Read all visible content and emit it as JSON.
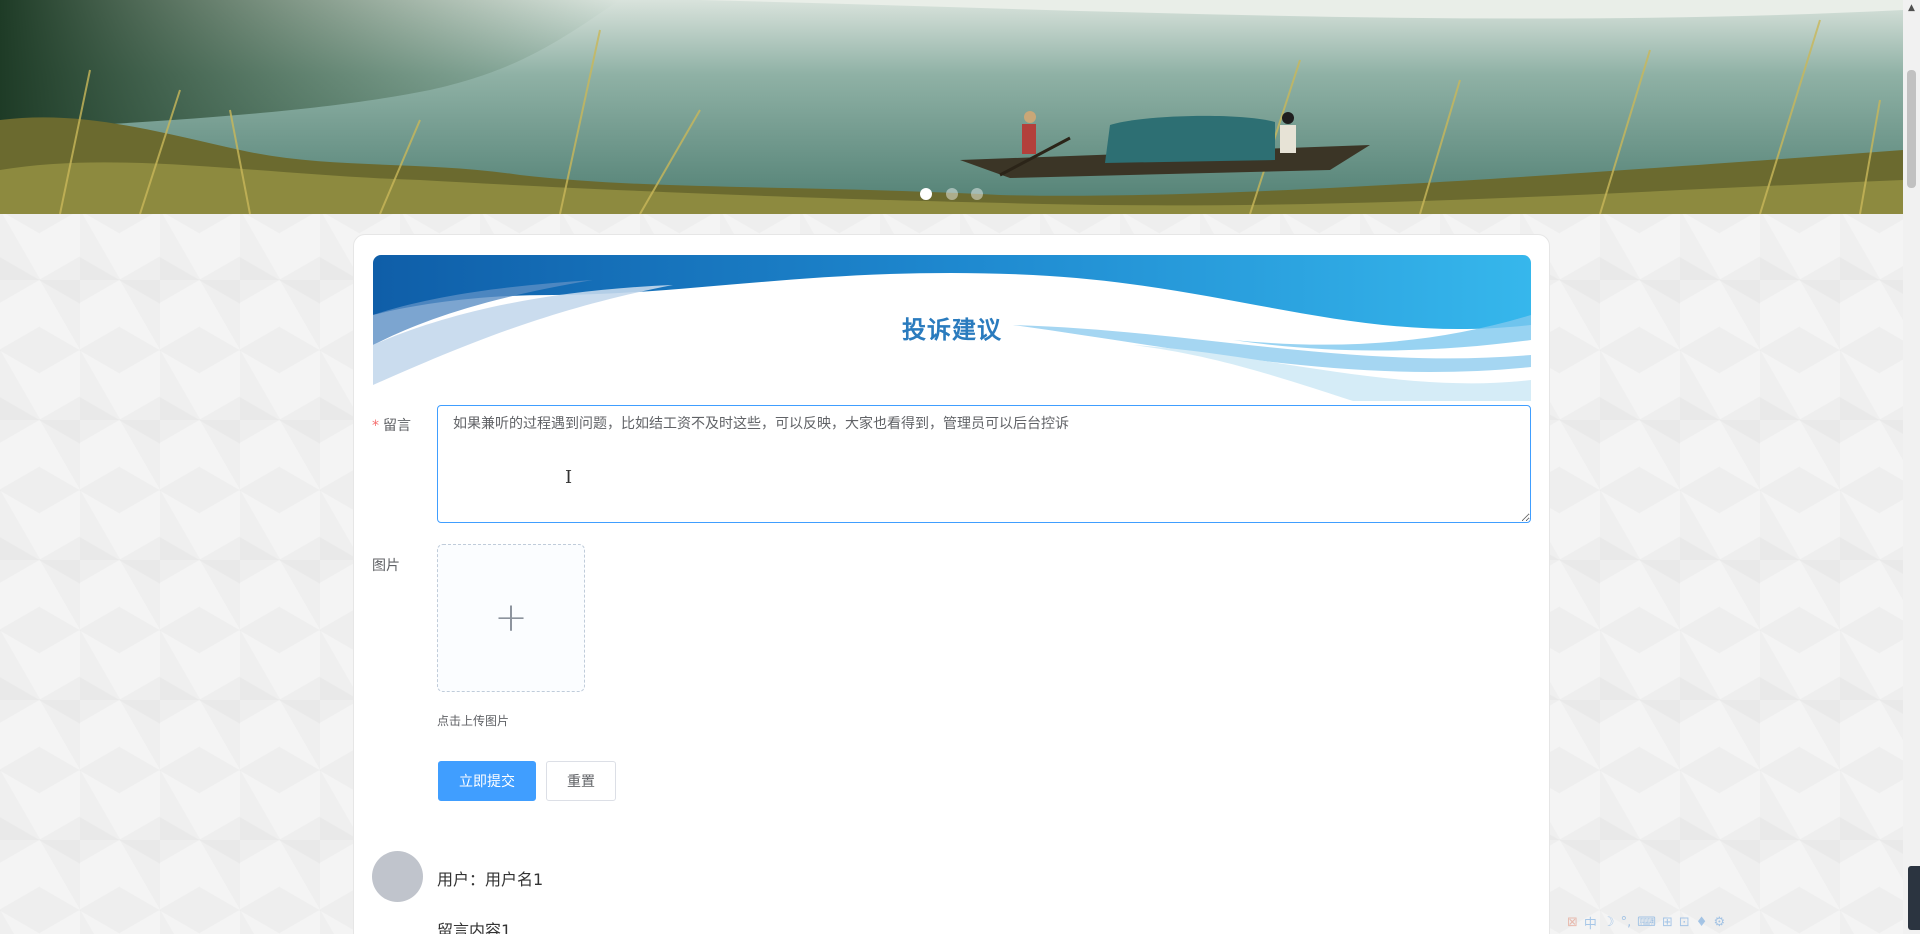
{
  "banner": {
    "dots": [
      {
        "active": true
      },
      {
        "active": false
      },
      {
        "active": false
      }
    ]
  },
  "card": {
    "title": "投诉建议"
  },
  "form": {
    "message": {
      "required_mark": "*",
      "label": "留言",
      "value": "如果兼听的过程遇到问题，比如结工资不及时这些，可以反映，大家也看得到，管理员可以后台控诉"
    },
    "image": {
      "label": "图片",
      "tip": "点击上传图片"
    },
    "submit_label": "立即提交",
    "reset_label": "重置"
  },
  "messages": [
    {
      "user_line": "用户：用户名1",
      "content": "留言内容1"
    }
  ],
  "ime_toolbar": {
    "icons": [
      "中",
      "☽",
      "°,",
      "⌨",
      "⊞",
      "⊡",
      "♦",
      "⚙"
    ]
  },
  "colors": {
    "primary": "#409eff",
    "title": "#2a7bbe",
    "required": "#f56c6c"
  }
}
